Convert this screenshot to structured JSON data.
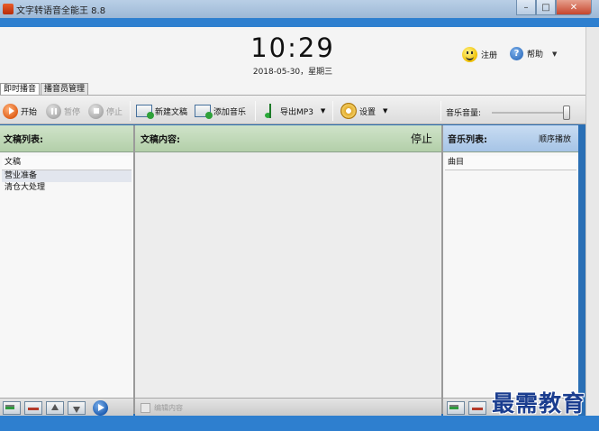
{
  "window": {
    "title": "文字转语音全能王 8.8",
    "controls": {
      "minimize": "–",
      "maximize": "□",
      "close": "✕"
    }
  },
  "header": {
    "clock": "10:29",
    "date": "2018-05-30，星期三",
    "register_label": "注册",
    "help_label": "帮助"
  },
  "tabs": [
    {
      "label": "即时播音",
      "active": true
    },
    {
      "label": "播音员管理",
      "active": false
    }
  ],
  "toolbar": {
    "start_label": "开始",
    "pause_label": "暂停",
    "stop_label": "停止",
    "new_doc_label": "新建文稿",
    "add_music_label": "添加音乐",
    "export_label": "导出MP3",
    "settings_label": "设置",
    "volume_label": "音乐音量:",
    "volume_level": 0.97
  },
  "doc_list": {
    "header": "文稿列表:",
    "column": "文稿",
    "items": [
      "营业准备",
      "清仓大处理"
    ]
  },
  "doc_content": {
    "header": "文稿内容:",
    "status": "停止"
  },
  "music_list": {
    "header": "音乐列表:",
    "mode": "顺序播放",
    "column": "曲目"
  },
  "footer": {
    "edit_label": "编辑内容"
  },
  "watermark": "最需教育"
}
